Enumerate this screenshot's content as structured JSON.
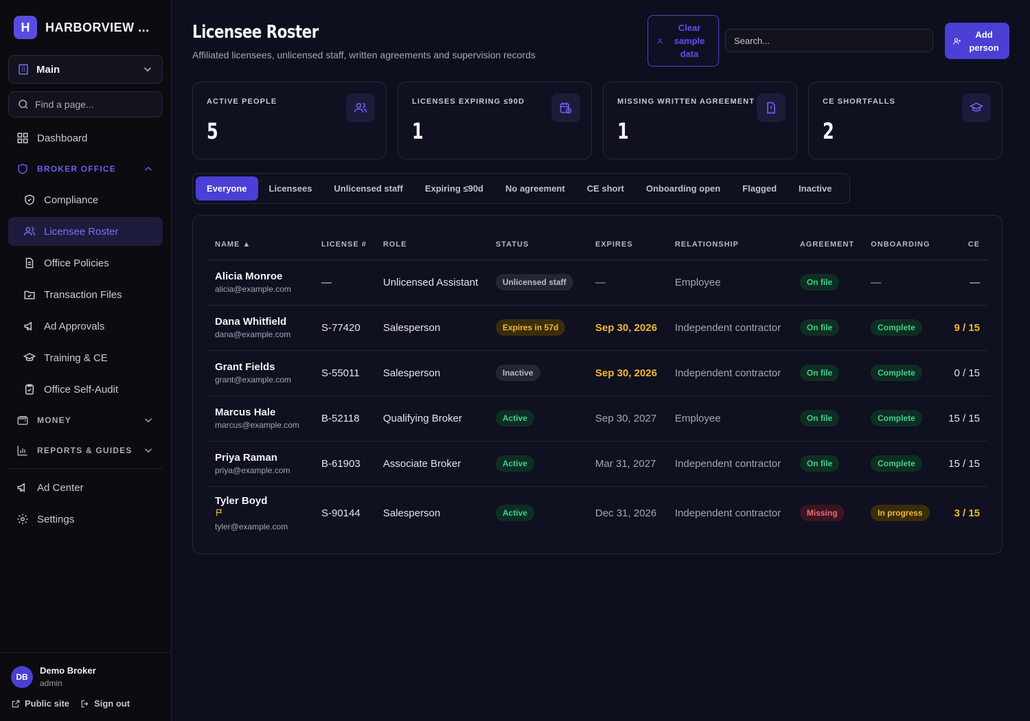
{
  "brand": {
    "initial": "H",
    "name": "HARBORVIEW ..."
  },
  "workspace": {
    "label": "Main"
  },
  "sidebar_search": {
    "placeholder": "Find a page..."
  },
  "nav": {
    "dashboard": "Dashboard",
    "broker_office": "BROKER OFFICE",
    "compliance": "Compliance",
    "licensee_roster": "Licensee Roster",
    "office_policies": "Office Policies",
    "transaction_files": "Transaction Files",
    "ad_approvals": "Ad Approvals",
    "training_ce": "Training & CE",
    "office_self_audit": "Office Self-Audit",
    "money": "MONEY",
    "reports_guides": "REPORTS & GUIDES",
    "ad_center": "Ad Center",
    "settings": "Settings"
  },
  "user": {
    "initials": "DB",
    "name": "Demo Broker",
    "role": "admin",
    "public_site": "Public site",
    "sign_out": "Sign out"
  },
  "header": {
    "title": "Licensee Roster",
    "subtitle": "Affiliated licensees, unlicensed staff, written agreements and supervision records",
    "clear_label": "Clear sample data",
    "search_placeholder": "Search...",
    "add_label": "Add person"
  },
  "stats": [
    {
      "label": "ACTIVE PEOPLE",
      "value": "5",
      "icon": "users-icon"
    },
    {
      "label": "LICENSES EXPIRING ≤90D",
      "value": "1",
      "icon": "calendar-clock-icon"
    },
    {
      "label": "MISSING WRITTEN AGREEMENT",
      "value": "1",
      "icon": "file-alert-icon"
    },
    {
      "label": "CE SHORTFALLS",
      "value": "2",
      "icon": "graduation-cap-icon"
    }
  ],
  "tabs": [
    "Everyone",
    "Licensees",
    "Unlicensed staff",
    "Expiring ≤90d",
    "No agreement",
    "CE short",
    "Onboarding open",
    "Flagged",
    "Inactive"
  ],
  "table": {
    "columns": [
      "NAME ▲",
      "LICENSE #",
      "ROLE",
      "STATUS",
      "EXPIRES",
      "RELATIONSHIP",
      "AGREEMENT",
      "ONBOARDING",
      "CE"
    ],
    "rows": [
      {
        "name": "Alicia Monroe",
        "email": "alicia@example.com",
        "license": "—",
        "role": "Unlicensed Assistant",
        "status": "Unlicensed staff",
        "expires": "—",
        "relationship": "Employee",
        "agreement": "On file",
        "onboarding": "—",
        "ce": "—"
      },
      {
        "name": "Dana Whitfield",
        "email": "dana@example.com",
        "license": "S-77420",
        "role": "Salesperson",
        "status": "Expires in 57d",
        "expires": "Sep 30, 2026",
        "relationship": "Independent contractor",
        "agreement": "On file",
        "onboarding": "Complete",
        "ce": "9 / 15"
      },
      {
        "name": "Grant Fields",
        "email": "grant@example.com",
        "license": "S-55011",
        "role": "Salesperson",
        "status": "Inactive",
        "expires": "Sep 30, 2026",
        "relationship": "Independent contractor",
        "agreement": "On file",
        "onboarding": "Complete",
        "ce": "0 / 15"
      },
      {
        "name": "Marcus Hale",
        "email": "marcus@example.com",
        "license": "B-52118",
        "role": "Qualifying Broker",
        "status": "Active",
        "expires": "Sep 30, 2027",
        "relationship": "Employee",
        "agreement": "On file",
        "onboarding": "Complete",
        "ce": "15 / 15"
      },
      {
        "name": "Priya Raman",
        "email": "priya@example.com",
        "license": "B-61903",
        "role": "Associate Broker",
        "status": "Active",
        "expires": "Mar 31, 2027",
        "relationship": "Independent contractor",
        "agreement": "On file",
        "onboarding": "Complete",
        "ce": "15 / 15"
      },
      {
        "name": "Tyler Boyd",
        "email": "tyler@example.com",
        "license": "S-90144",
        "role": "Salesperson",
        "status": "Active",
        "expires": "Dec 31, 2026",
        "relationship": "Independent contractor",
        "agreement": "Missing",
        "onboarding": "In progress",
        "ce": "3 / 15"
      }
    ]
  },
  "colors": {
    "accent": "#4b3fd6",
    "success": "#3ecf8e",
    "warning": "#f2b830",
    "danger": "#f06a78"
  }
}
